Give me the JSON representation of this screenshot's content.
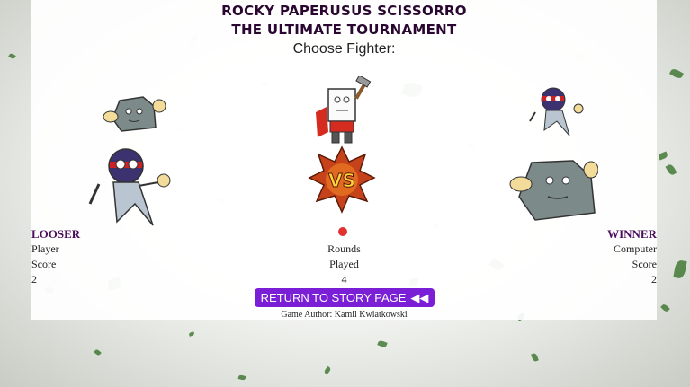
{
  "game": {
    "title_line1": "ROCKY PAPERUSUS SCISSORRO",
    "title_line2": "THE ULTIMATE TOURNAMENT",
    "choose_label": "Choose Fighter:"
  },
  "player": {
    "result": "LOOSER",
    "label": "Player",
    "score_label": "Score",
    "score": "2"
  },
  "rounds": {
    "label_line1": "Rounds",
    "label_line2": "Played",
    "count": "4"
  },
  "computer": {
    "result": "WINNER",
    "label": "Computer",
    "score_label": "Score",
    "score": "2"
  },
  "return_button": {
    "label": "RETURN TO STORY PAGE"
  },
  "author": "Game Author: Kamil Kwiatkowski",
  "colors": {
    "accent": "#7a1fd6",
    "title": "#2a0730",
    "result_text": "#4b0d5c",
    "leaf_dark": "#2e6b1f"
  },
  "fighters": [
    {
      "name": "rock",
      "icon": "rock-fighter-icon"
    },
    {
      "name": "paper",
      "icon": "paper-fighter-icon"
    },
    {
      "name": "scissors",
      "icon": "scissors-ninja-icon"
    }
  ]
}
